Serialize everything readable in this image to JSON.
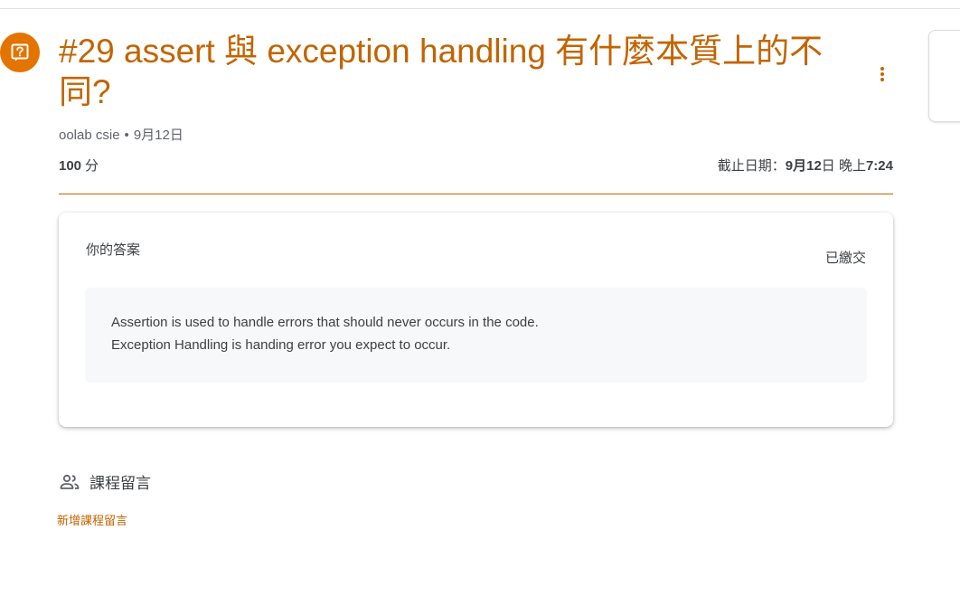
{
  "assignment": {
    "title": "#29 assert 與 exception handling 有什麼本質上的不同?",
    "author": "oolab csie",
    "separator": "•",
    "posted_date": "9月12日",
    "points_value": "100",
    "points_unit": "分",
    "due_label": "截止日期：",
    "due_month": "9月",
    "due_day": "12",
    "due_day_suffix": "日 晚上",
    "due_time": "7:24"
  },
  "your_work": {
    "heading": "你的答案",
    "status": "已繳交",
    "answer_lines": [
      "Assertion is used to handle errors that should never occurs in the code.",
      "Exception Handling is handing error you expect to occur."
    ]
  },
  "class_comments": {
    "title": "課程留言",
    "add_link": "新增課程留言"
  },
  "icons": {
    "assignment": "question-assignment-icon",
    "more": "more-vert-icon",
    "comments": "people-icon"
  },
  "colors": {
    "accent": "#c26401",
    "icon_bg": "#e37400",
    "text": "#3c4043",
    "muted": "#5f6368",
    "answer_bg": "#f7f8fa"
  }
}
